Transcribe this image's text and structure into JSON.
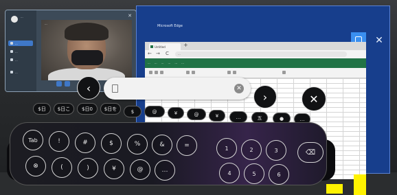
{
  "call_window": {
    "user_name": "...",
    "video_label": "...",
    "nav_items": [
      "...",
      "...",
      "...",
      "..."
    ],
    "close_glyph": "✕"
  },
  "edge_window": {
    "title": "Microsoft Edge",
    "close_glyph": "✕",
    "tab_title": "Untitled",
    "new_tab_glyph": "+",
    "nav_back_glyph": "←",
    "nav_forward_glyph": "→",
    "nav_refresh_glyph": "C",
    "url": "...",
    "excel_tabs": [
      "...",
      "...",
      "...",
      "...",
      "...",
      "..."
    ]
  },
  "input_bar": {
    "back_glyph": "‹",
    "forward_glyph": "›",
    "close_glyph": "✕",
    "clear_glyph": "✕",
    "value": ""
  },
  "candidates": [
    "$日",
    "$日こ",
    "$日0",
    "$日を",
    "$",
    "@",
    "¥",
    "@",
    "¥",
    "…",
    "五",
    "●",
    "…"
  ],
  "keyboard": {
    "row1": [
      "Tab",
      "!",
      "#",
      "$",
      "%",
      "&",
      "="
    ],
    "row2": [
      "⊗",
      "(",
      ")",
      "¥",
      "@",
      "…"
    ],
    "numpad_row1": [
      "1",
      "2",
      "3"
    ],
    "numpad_row2": [
      "4",
      "5",
      "6"
    ],
    "backspace_glyph": "⌫"
  },
  "colors": {
    "edge_frame": "#173e8c",
    "excel_green": "#217346",
    "dock_button": "#3a8ff0",
    "highlight_cell": "#fff200"
  }
}
